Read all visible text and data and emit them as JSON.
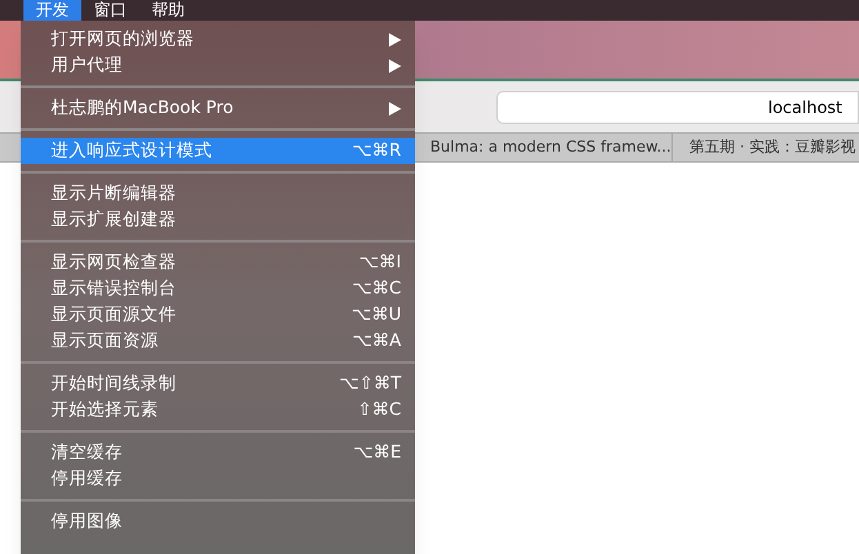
{
  "menu_bar": [
    {
      "label": "开发",
      "selected": true
    },
    {
      "label": "窗口",
      "selected": false
    },
    {
      "label": "帮助",
      "selected": false
    }
  ],
  "browser": {
    "address": "localhost",
    "tabs": [
      {
        "label": "Bulma: a modern CSS framew..."
      },
      {
        "label": "第五期 · 实践：豆瓣影视"
      }
    ]
  },
  "menu": [
    {
      "kind": "item",
      "label": "打开网页的浏览器",
      "submenu": true,
      "selected": false
    },
    {
      "kind": "item",
      "label": "用户代理",
      "submenu": true,
      "selected": false
    },
    {
      "kind": "separator"
    },
    {
      "kind": "item",
      "label": "杜志鹏的MacBook Pro",
      "submenu": true,
      "selected": false
    },
    {
      "kind": "separator"
    },
    {
      "kind": "item",
      "label": "进入响应式设计模式",
      "shortcut": "⌥⌘R",
      "selected": true
    },
    {
      "kind": "separator"
    },
    {
      "kind": "item",
      "label": "显示片断编辑器",
      "selected": false
    },
    {
      "kind": "item",
      "label": "显示扩展创建器",
      "selected": false
    },
    {
      "kind": "separator"
    },
    {
      "kind": "item",
      "label": "显示网页检查器",
      "shortcut": "⌥⌘I",
      "selected": false
    },
    {
      "kind": "item",
      "label": "显示错误控制台",
      "shortcut": "⌥⌘C",
      "selected": false
    },
    {
      "kind": "item",
      "label": "显示页面源文件",
      "shortcut": "⌥⌘U",
      "selected": false
    },
    {
      "kind": "item",
      "label": "显示页面资源",
      "shortcut": "⌥⌘A",
      "selected": false
    },
    {
      "kind": "separator"
    },
    {
      "kind": "item",
      "label": "开始时间线录制",
      "shortcut": "⌥⇧⌘T",
      "selected": false
    },
    {
      "kind": "item",
      "label": "开始选择元素",
      "shortcut": "⇧⌘C",
      "selected": false
    },
    {
      "kind": "separator"
    },
    {
      "kind": "item",
      "label": "清空缓存",
      "shortcut": "⌥⌘E",
      "selected": false
    },
    {
      "kind": "item",
      "label": "停用缓存",
      "selected": false
    },
    {
      "kind": "separator"
    },
    {
      "kind": "item",
      "label": "停用图像",
      "selected": false
    }
  ]
}
